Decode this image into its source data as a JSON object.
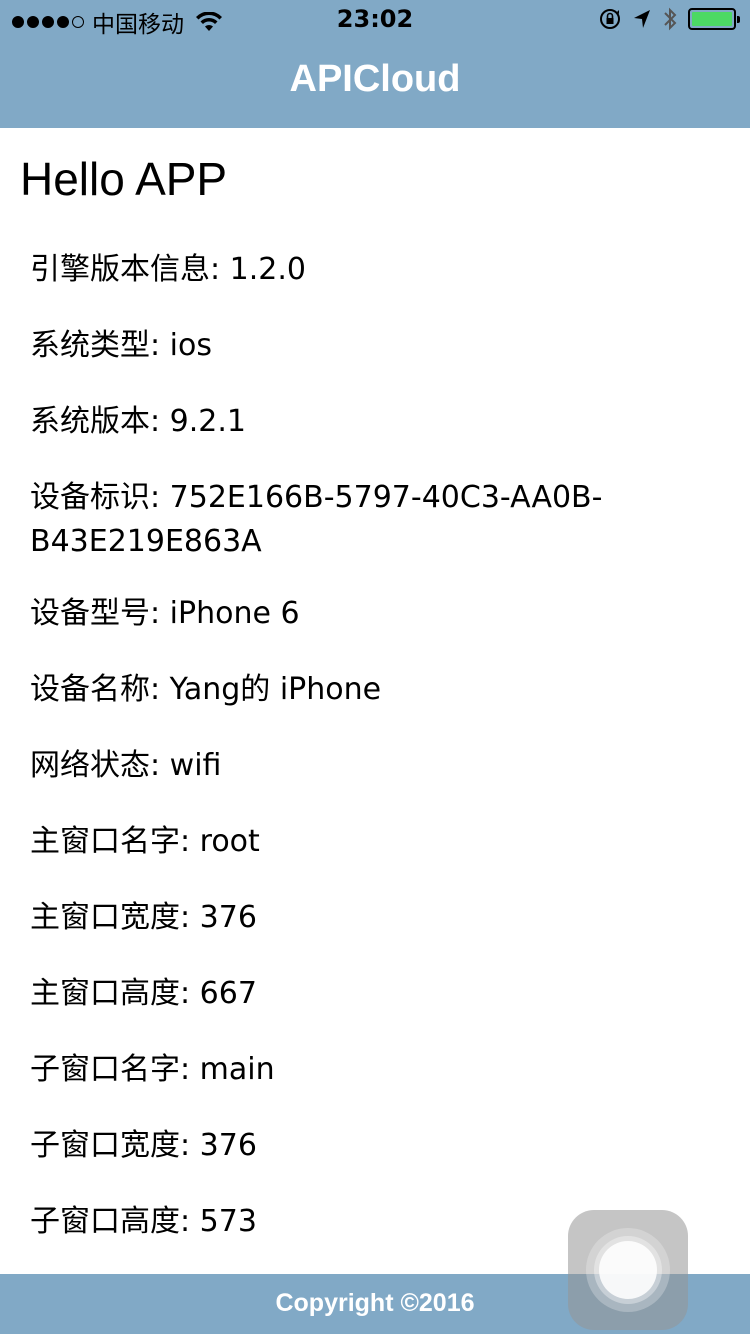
{
  "status_bar": {
    "signal_filled": 4,
    "signal_total": 5,
    "carrier": "中国移动",
    "time": "23:02",
    "wifi_icon": "wifi-icon",
    "orientation_lock_icon": "orientation-lock-icon",
    "location_icon": "location-arrow-icon",
    "bluetooth_icon": "bluetooth-icon",
    "battery_icon": "battery-icon",
    "battery_color": "#4cd964"
  },
  "header": {
    "title": "APICloud",
    "background": "#81a9c6"
  },
  "main": {
    "heading": "Hello APP",
    "info": [
      {
        "label": "引擎版本信息",
        "value": "1.2.0"
      },
      {
        "label": "系统类型",
        "value": "ios"
      },
      {
        "label": "系统版本",
        "value": "9.2.1"
      },
      {
        "label": "设备标识",
        "value": "752E166B-5797-40C3-AA0B-",
        "value_cont": "B43E219E863A"
      },
      {
        "label": "设备型号",
        "value": "iPhone 6"
      },
      {
        "label": "设备名称",
        "value": "Yang的 iPhone"
      },
      {
        "label": "网络状态",
        "value": "wifi"
      },
      {
        "label": "主窗口名字",
        "value": "root"
      },
      {
        "label": "主窗口宽度",
        "value": "376"
      },
      {
        "label": "主窗口高度",
        "value": "667"
      },
      {
        "label": "子窗口名字",
        "value": "main"
      },
      {
        "label": "子窗口宽度",
        "value": "376"
      },
      {
        "label": "子窗口高度",
        "value": "573"
      }
    ]
  },
  "footer": {
    "text": "Copyright ©2016"
  },
  "overlay": {
    "assistive_touch_icon": "assistive-touch-icon"
  }
}
